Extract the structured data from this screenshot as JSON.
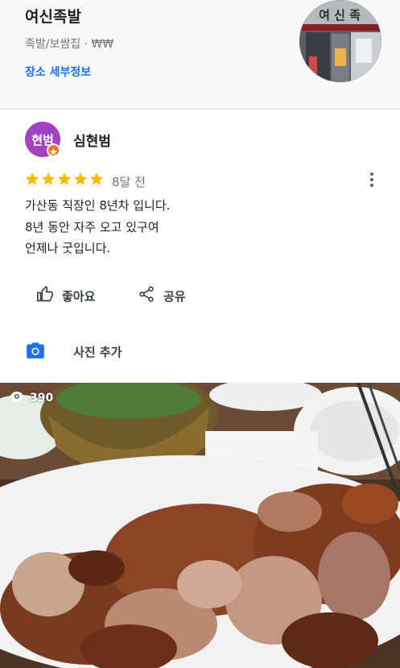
{
  "place": {
    "name": "여신족발",
    "category": "족발/보쌈집 · ₩₩",
    "details_link": "장소 세부정보",
    "thumbnail_sign": "여 신 족"
  },
  "review": {
    "reviewer_initials": "현범",
    "reviewer_name": "심현범",
    "rating": 5,
    "time_ago": "8달 전",
    "text_lines": [
      "가산동 직장인 8년차 입니다.",
      "8년 동안 자주 오고 있구여",
      "언제나 굿입니다."
    ]
  },
  "actions": {
    "like_label": "좋아요",
    "share_label": "공유"
  },
  "add_photo": {
    "label": "사진 추가"
  },
  "photo": {
    "view_count": "390"
  },
  "colors": {
    "link_blue": "#1a73e8",
    "star_yellow": "#fbbc04",
    "avatar_purple": "#a142c2",
    "badge_orange": "#f3742a",
    "camera_blue": "#1a73e8"
  },
  "icons": [
    "thumbs-up-icon",
    "share-icon",
    "camera-icon",
    "eye-icon",
    "more-vert-icon",
    "star-icon"
  ]
}
